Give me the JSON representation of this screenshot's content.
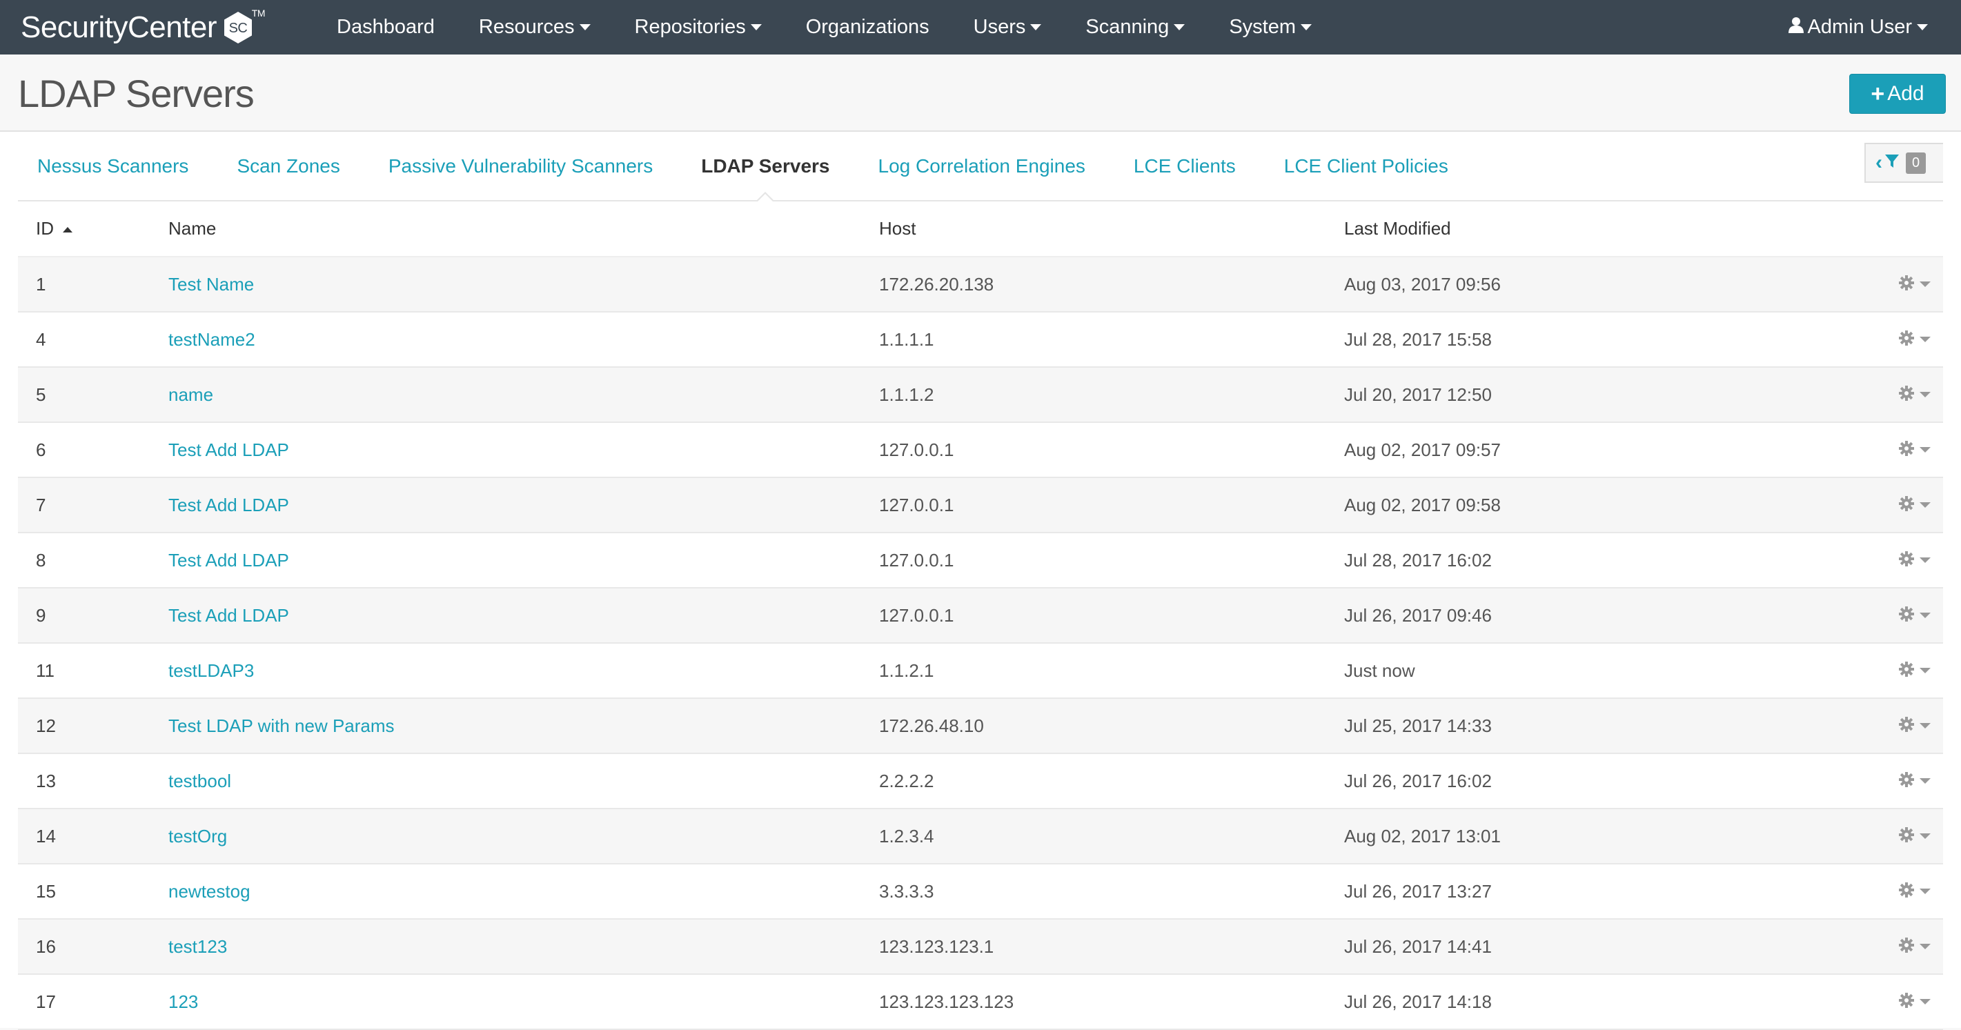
{
  "app": {
    "logo_text": "SecurityCenter",
    "logo_badge": "SC",
    "logo_tm": "TM"
  },
  "nav": {
    "items": [
      {
        "label": "Dashboard"
      },
      {
        "label": "Resources"
      },
      {
        "label": "Repositories"
      },
      {
        "label": "Organizations"
      },
      {
        "label": "Users"
      },
      {
        "label": "Scanning"
      },
      {
        "label": "System"
      }
    ],
    "user_label": "Admin User"
  },
  "page": {
    "title": "LDAP Servers",
    "add_label": "Add"
  },
  "tabs": [
    {
      "label": "Nessus Scanners"
    },
    {
      "label": "Scan Zones"
    },
    {
      "label": "Passive Vulnerability Scanners"
    },
    {
      "label": "LDAP Servers"
    },
    {
      "label": "Log Correlation Engines"
    },
    {
      "label": "LCE Clients"
    },
    {
      "label": "LCE Client Policies"
    }
  ],
  "filter": {
    "count": "0"
  },
  "table": {
    "headers": {
      "id": "ID",
      "name": "Name",
      "host": "Host",
      "modified": "Last Modified"
    },
    "rows": [
      {
        "id": "1",
        "name": "Test Name",
        "host": "172.26.20.138",
        "modified": "Aug 03, 2017 09:56"
      },
      {
        "id": "4",
        "name": "testName2",
        "host": "1.1.1.1",
        "modified": "Jul 28, 2017 15:58"
      },
      {
        "id": "5",
        "name": "name",
        "host": "1.1.1.2",
        "modified": "Jul 20, 2017 12:50"
      },
      {
        "id": "6",
        "name": "Test Add LDAP",
        "host": "127.0.0.1",
        "modified": "Aug 02, 2017 09:57"
      },
      {
        "id": "7",
        "name": "Test Add LDAP",
        "host": "127.0.0.1",
        "modified": "Aug 02, 2017 09:58"
      },
      {
        "id": "8",
        "name": "Test Add LDAP",
        "host": "127.0.0.1",
        "modified": "Jul 28, 2017 16:02"
      },
      {
        "id": "9",
        "name": "Test Add LDAP",
        "host": "127.0.0.1",
        "modified": "Jul 26, 2017 09:46"
      },
      {
        "id": "11",
        "name": "testLDAP3",
        "host": "1.1.2.1",
        "modified": "Just now"
      },
      {
        "id": "12",
        "name": "Test LDAP with new Params",
        "host": "172.26.48.10",
        "modified": "Jul 25, 2017 14:33"
      },
      {
        "id": "13",
        "name": "testbool",
        "host": "2.2.2.2",
        "modified": "Jul 26, 2017 16:02"
      },
      {
        "id": "14",
        "name": "testOrg",
        "host": "1.2.3.4",
        "modified": "Aug 02, 2017 13:01"
      },
      {
        "id": "15",
        "name": "newtestog",
        "host": "3.3.3.3",
        "modified": "Jul 26, 2017 13:27"
      },
      {
        "id": "16",
        "name": "test123",
        "host": "123.123.123.1",
        "modified": "Jul 26, 2017 14:41"
      },
      {
        "id": "17",
        "name": "123",
        "host": "123.123.123.123",
        "modified": "Jul 26, 2017 14:18"
      }
    ]
  },
  "colors": {
    "nav_bg": "#3b4752",
    "accent": "#1b9fb8"
  },
  "icons": {
    "user": "user-icon",
    "plus": "plus-icon",
    "filter": "filter-icon",
    "gear": "gear-icon",
    "sort": "sort-asc-icon"
  }
}
